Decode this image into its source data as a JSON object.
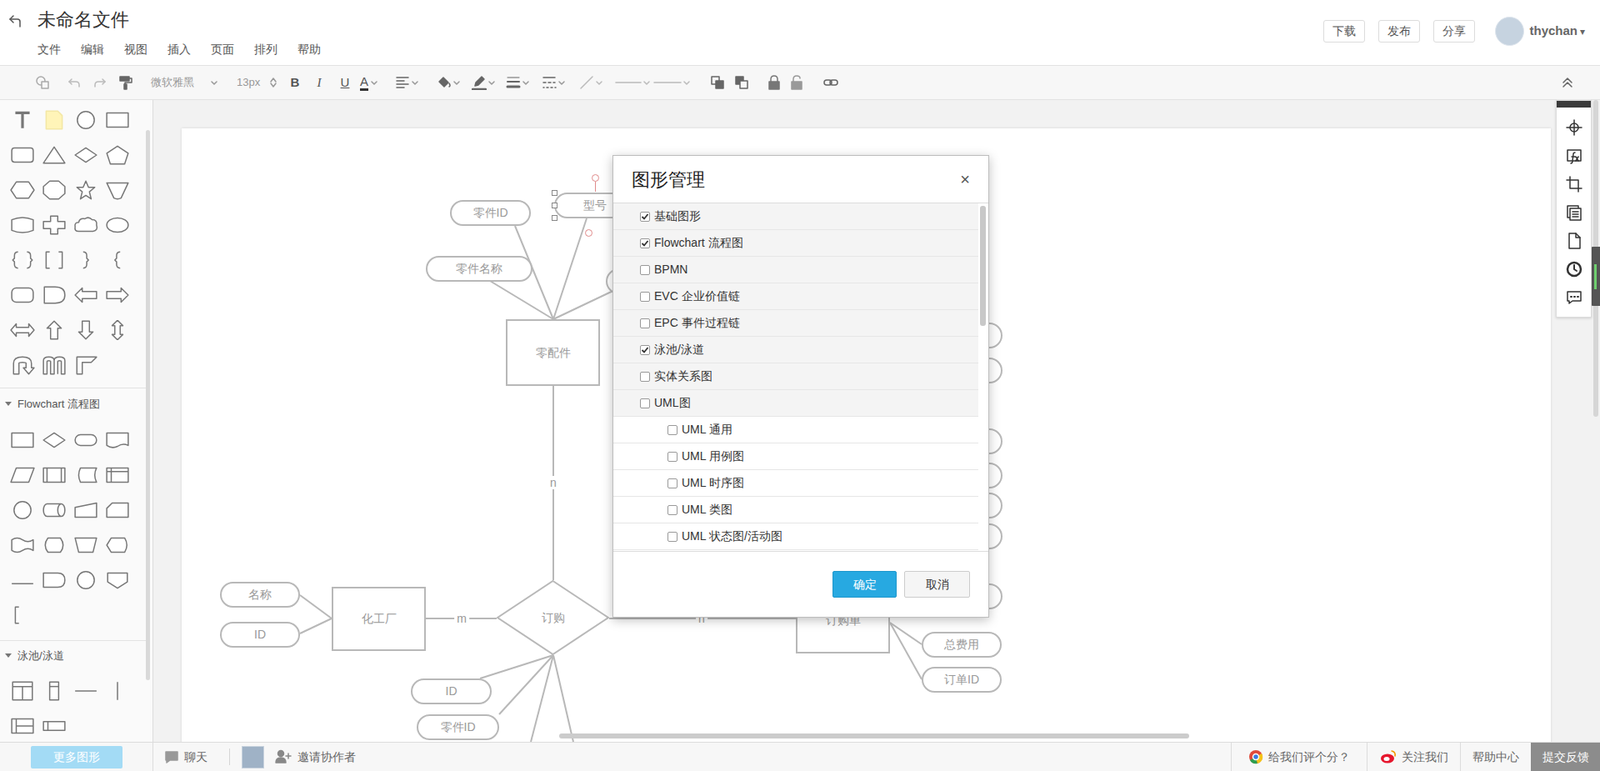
{
  "header": {
    "title": "未命名文件",
    "menu": [
      "文件",
      "编辑",
      "视图",
      "插入",
      "页面",
      "排列",
      "帮助"
    ],
    "actions": [
      "下载",
      "发布",
      "分享"
    ],
    "user": {
      "name": "thychan",
      "caret": "▾"
    }
  },
  "toolbar": {
    "font": "微软雅黑",
    "font_size": "13px",
    "format": [
      "B",
      "I",
      "U",
      "A"
    ]
  },
  "sidebar": {
    "sections": [
      {
        "title": "Flowchart 流程图",
        "expanded": true
      },
      {
        "title": "泳池/泳道",
        "expanded": true
      }
    ],
    "more_button": "更多图形"
  },
  "canvas": {
    "nodes": [
      {
        "label": "零配件",
        "kind": "entity",
        "selected": false
      },
      {
        "label": "化工厂",
        "kind": "entity",
        "selected": false
      },
      {
        "label": "订购单",
        "kind": "entity",
        "selected": false
      },
      {
        "label": "订购",
        "kind": "relationship",
        "selected": false
      },
      {
        "label": "零件ID",
        "kind": "attribute",
        "selected": false
      },
      {
        "label": "型号",
        "kind": "attribute",
        "selected": true
      },
      {
        "label": "零件名称",
        "kind": "attribute",
        "selected": false
      },
      {
        "label": "名称",
        "kind": "attribute",
        "selected": false
      },
      {
        "label": "ID",
        "kind": "attribute",
        "selected": false
      },
      {
        "label": "ID",
        "kind": "attribute",
        "selected": false
      },
      {
        "label": "零件ID",
        "kind": "attribute",
        "selected": false
      },
      {
        "label": "总费用",
        "kind": "attribute",
        "selected": false
      },
      {
        "label": "订单ID",
        "kind": "attribute",
        "selected": false
      }
    ],
    "edge_labels": [
      "n",
      "m",
      "n"
    ]
  },
  "dialog": {
    "title": "图形管理",
    "close": "×",
    "items": [
      {
        "label": "基础图形",
        "kind": "group",
        "checked": true
      },
      {
        "label": "Flowchart 流程图",
        "kind": "group",
        "checked": true
      },
      {
        "label": "BPMN",
        "kind": "group",
        "checked": false
      },
      {
        "label": "EVC 企业价值链",
        "kind": "group",
        "checked": false
      },
      {
        "label": "EPC 事件过程链",
        "kind": "group",
        "checked": false
      },
      {
        "label": "泳池/泳道",
        "kind": "group",
        "checked": true
      },
      {
        "label": "实体关系图",
        "kind": "group",
        "checked": false
      },
      {
        "label": "UML图",
        "kind": "group",
        "checked": false
      },
      {
        "label": "UML 通用",
        "kind": "sub",
        "checked": false
      },
      {
        "label": "UML 用例图",
        "kind": "sub",
        "checked": false
      },
      {
        "label": "UML 时序图",
        "kind": "sub",
        "checked": false
      },
      {
        "label": "UML 类图",
        "kind": "sub",
        "checked": false
      },
      {
        "label": "UML 状态图/活动图",
        "kind": "sub",
        "checked": false
      }
    ],
    "buttons": [
      {
        "label": "确定",
        "kind": "primary"
      },
      {
        "label": "取消",
        "kind": "secondary"
      }
    ]
  },
  "bottom_bar": {
    "chat": "聊天",
    "invite": "邀请协作者",
    "links": [
      "给我们评个分？",
      "关注我们",
      "帮助中心"
    ],
    "feedback": "提交反馈"
  }
}
